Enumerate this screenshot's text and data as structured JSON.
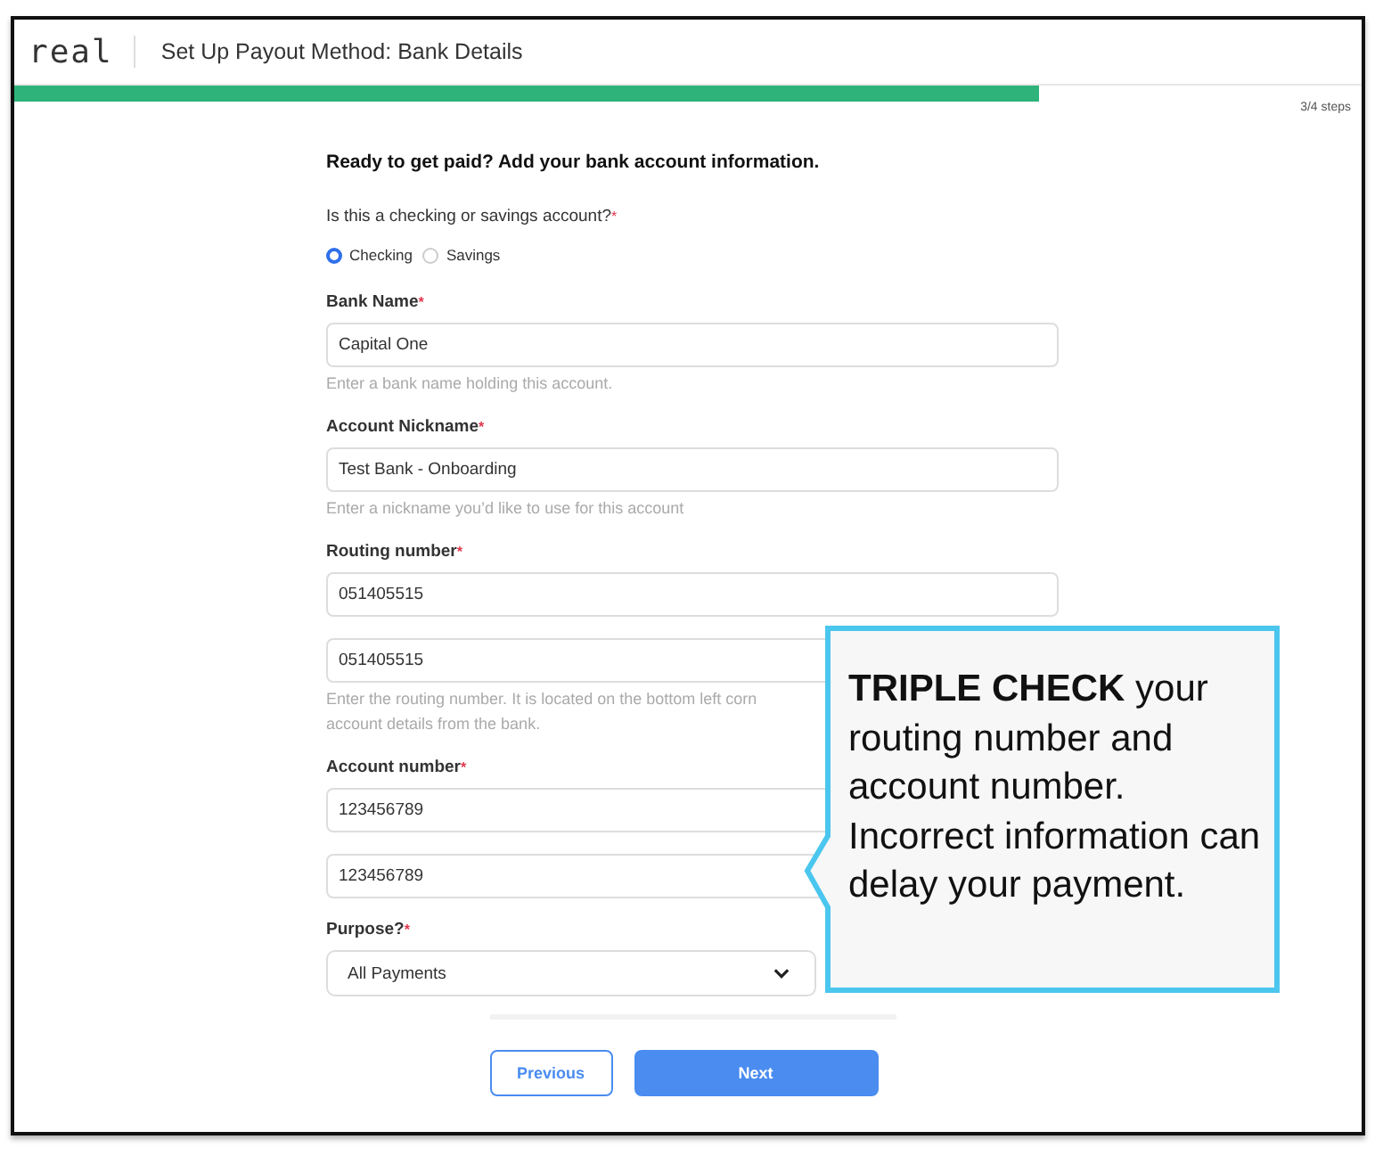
{
  "header": {
    "logo": "real",
    "title": "Set Up Payout Method: Bank Details"
  },
  "progress": {
    "level": 0.76,
    "label": "3/4 steps"
  },
  "form": {
    "heading": "Ready to get paid? Add your bank account information.",
    "account_type": {
      "label": "Is this a checking or savings account?",
      "required": "*",
      "options": [
        {
          "label": "Checking",
          "selected": true
        },
        {
          "label": "Savings",
          "selected": false
        }
      ]
    },
    "fields": [
      {
        "label": "Bank Name",
        "required": "*",
        "kind": "text",
        "values": [
          "Capital One"
        ],
        "hint": [
          "Enter a bank name holding this account."
        ]
      },
      {
        "label": "Account Nickname",
        "required": "*",
        "kind": "text",
        "values": [
          "Test Bank - Onboarding"
        ],
        "hint": [
          "Enter a nickname you’d like to use for this account"
        ]
      },
      {
        "label": "Routing number",
        "required": "*",
        "kind": "text",
        "values": [
          "051405515",
          "051405515"
        ],
        "hint": [
          "Enter the routing number. It is located on the bottom left corn",
          "account details from the bank."
        ]
      },
      {
        "label": "Account number",
        "required": "*",
        "kind": "text",
        "values": [
          "123456789",
          "123456789"
        ]
      },
      {
        "label": "Purpose?",
        "required": "*",
        "kind": "select",
        "values": [
          "All Payments"
        ]
      }
    ],
    "buttons": [
      {
        "label": "Previous",
        "kind": "secondary"
      },
      {
        "label": "Next",
        "kind": "primary"
      }
    ]
  },
  "callout": {
    "text": "**TRIPLE CHECK** your routing number and account number. Incorrect information can delay your payment."
  }
}
